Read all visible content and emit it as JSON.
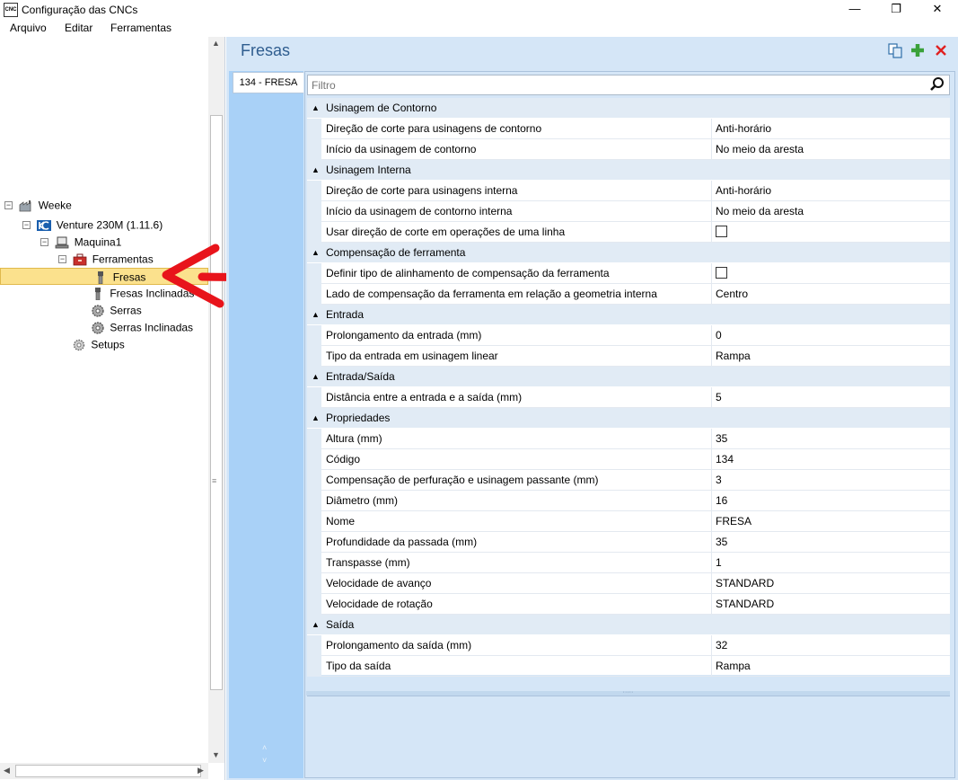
{
  "window": {
    "title": "Configuração das CNCs",
    "icon_text": "CNC",
    "minimize": "—",
    "maximize": "❐",
    "close": "✕"
  },
  "menu": {
    "items": [
      "Arquivo",
      "Editar",
      "Ferramentas"
    ]
  },
  "tree": {
    "nodes": [
      {
        "label": "Weeke",
        "icon": "factory-icon"
      },
      {
        "label": "Venture 230M (1.11.6)",
        "icon": "machine-logo-icon"
      },
      {
        "label": "Maquina1",
        "icon": "machine-icon"
      },
      {
        "label": "Ferramentas",
        "icon": "toolbox-icon"
      },
      {
        "label": "Fresas",
        "icon": "mill-tool-icon",
        "selected": true
      },
      {
        "label": "Fresas Inclinadas",
        "icon": "mill-tool-icon"
      },
      {
        "label": "Serras",
        "icon": "saw-gear-icon"
      },
      {
        "label": "Serras Inclinadas",
        "icon": "saw-gear-icon"
      },
      {
        "label": "Setups",
        "icon": "gear-icon"
      }
    ]
  },
  "panel": {
    "title": "Fresas",
    "tab": "134 - FRESA",
    "filter_placeholder": "Filtro",
    "header_icons": [
      "copy-icon",
      "add-icon",
      "delete-icon"
    ]
  },
  "grid": {
    "categories": [
      {
        "name": "Usinagem de Contorno",
        "props": [
          {
            "name": "Direção de corte para usinagens de contorno",
            "value": "Anti-horário"
          },
          {
            "name": "Início da usinagem de contorno",
            "value": "No meio da aresta"
          }
        ]
      },
      {
        "name": "Usinagem Interna",
        "props": [
          {
            "name": "Direção de corte para usinagens interna",
            "value": "Anti-horário"
          },
          {
            "name": "Início da usinagem de contorno interna",
            "value": "No meio da aresta"
          },
          {
            "name": "Usar direção de corte em operações de uma linha",
            "value": "",
            "checkbox": true
          }
        ]
      },
      {
        "name": "Compensação de ferramenta",
        "props": [
          {
            "name": "Definir tipo de alinhamento de compensação da ferramenta",
            "value": "",
            "checkbox": true
          },
          {
            "name": "Lado de compensação da ferramenta em relação a geometria interna",
            "value": "Centro"
          }
        ]
      },
      {
        "name": "Entrada",
        "props": [
          {
            "name": "Prolongamento da entrada (mm)",
            "value": "0"
          },
          {
            "name": "Tipo da entrada em usinagem linear",
            "value": "Rampa"
          }
        ]
      },
      {
        "name": "Entrada/Saída",
        "props": [
          {
            "name": "Distância entre a entrada e a saída (mm)",
            "value": "5"
          }
        ]
      },
      {
        "name": "Propriedades",
        "props": [
          {
            "name": "Altura (mm)",
            "value": "35"
          },
          {
            "name": "Código",
            "value": "134"
          },
          {
            "name": "Compensação de perfuração e usinagem passante (mm)",
            "value": "3"
          },
          {
            "name": "Diâmetro (mm)",
            "value": "16"
          },
          {
            "name": "Nome",
            "value": "FRESA"
          },
          {
            "name": "Profundidade da passada (mm)",
            "value": "35"
          },
          {
            "name": "Transpasse (mm)",
            "value": "1"
          },
          {
            "name": "Velocidade de avanço",
            "value": "STANDARD"
          },
          {
            "name": "Velocidade de rotação",
            "value": "STANDARD"
          }
        ]
      },
      {
        "name": "Saída",
        "props": [
          {
            "name": "Prolongamento da saída (mm)",
            "value": "32"
          },
          {
            "name": "Tipo da saída",
            "value": "Rampa"
          }
        ]
      }
    ]
  },
  "colors": {
    "accent": "#2f5d8f",
    "selection": "#fbe18d",
    "annotation": "#e8141b"
  }
}
